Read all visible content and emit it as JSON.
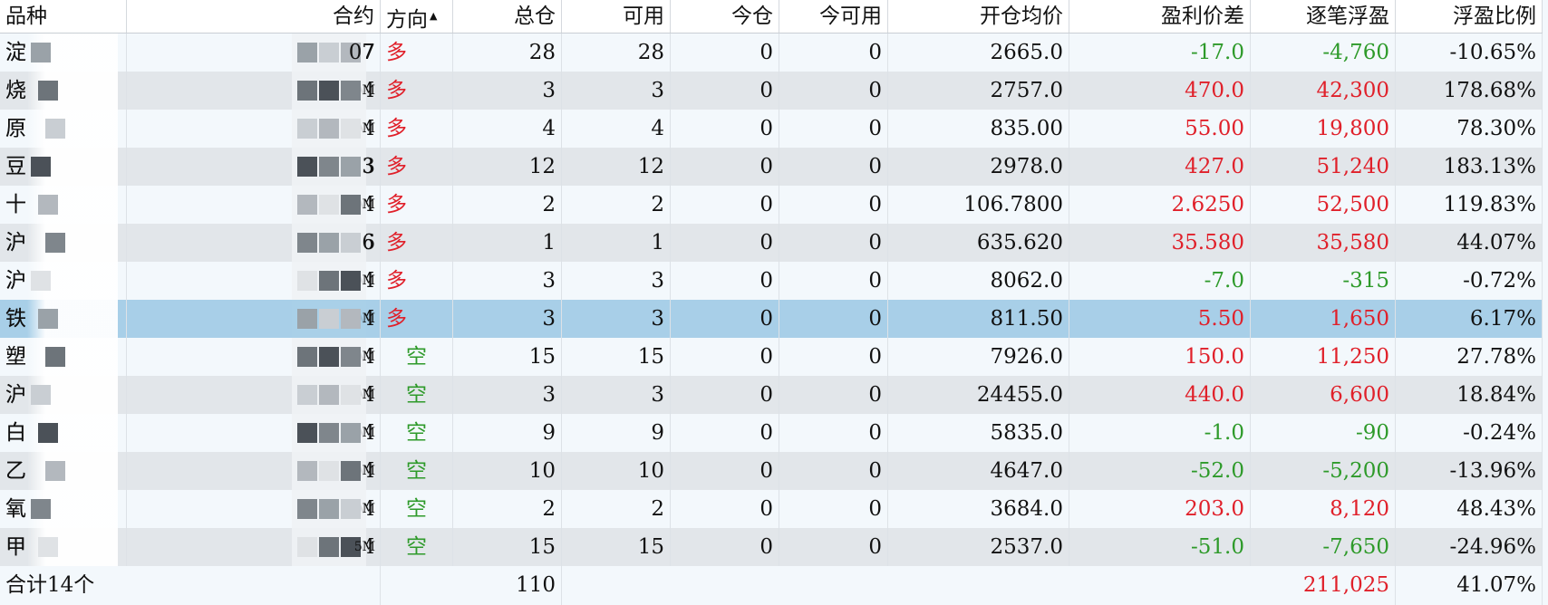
{
  "columns": [
    {
      "key": "variety",
      "label": "品种"
    },
    {
      "key": "contract",
      "label": "合约"
    },
    {
      "key": "direction",
      "label": "方向"
    },
    {
      "key": "total",
      "label": "总仓"
    },
    {
      "key": "available",
      "label": "可用"
    },
    {
      "key": "today",
      "label": "今仓"
    },
    {
      "key": "today_avail",
      "label": "今可用"
    },
    {
      "key": "open_avg",
      "label": "开仓均价"
    },
    {
      "key": "pnl_diff",
      "label": "盈利价差"
    },
    {
      "key": "float_pnl",
      "label": "逐笔浮盈"
    },
    {
      "key": "float_ratio",
      "label": "浮盈比例"
    }
  ],
  "sort_indicator": "▲",
  "rows": [
    {
      "variety": "淀",
      "contract": "07",
      "direction": "多",
      "dir_color": "red",
      "total": "28",
      "available": "28",
      "today": "0",
      "today_avail": "0",
      "open_avg": "2665.0",
      "pnl_diff": "-17.0",
      "pnl_color": "green",
      "float_pnl": "-4,760",
      "float_ratio": "-10.65%"
    },
    {
      "variety": "烧",
      "contract": "M",
      "direction": "多",
      "dir_color": "red",
      "total": "3",
      "available": "3",
      "today": "0",
      "today_avail": "0",
      "open_avg": "2757.0",
      "pnl_diff": "470.0",
      "pnl_color": "red",
      "float_pnl": "42,300",
      "float_ratio": "178.68%"
    },
    {
      "variety": "原",
      "contract": "M",
      "direction": "多",
      "dir_color": "red",
      "total": "4",
      "available": "4",
      "today": "0",
      "today_avail": "0",
      "open_avg": "835.00",
      "pnl_diff": "55.00",
      "pnl_color": "red",
      "float_pnl": "19,800",
      "float_ratio": "78.30%"
    },
    {
      "variety": "豆",
      "contract": "3",
      "direction": "多",
      "dir_color": "red",
      "total": "12",
      "available": "12",
      "today": "0",
      "today_avail": "0",
      "open_avg": "2978.0",
      "pnl_diff": "427.0",
      "pnl_color": "red",
      "float_pnl": "51,240",
      "float_ratio": "183.13%"
    },
    {
      "variety": "十",
      "contract": "M",
      "direction": "多",
      "dir_color": "red",
      "total": "2",
      "available": "2",
      "today": "0",
      "today_avail": "0",
      "open_avg": "106.7800",
      "pnl_diff": "2.6250",
      "pnl_color": "red",
      "float_pnl": "52,500",
      "float_ratio": "119.83%"
    },
    {
      "variety": "沪",
      "contract": "6",
      "direction": "多",
      "dir_color": "red",
      "total": "1",
      "available": "1",
      "today": "0",
      "today_avail": "0",
      "open_avg": "635.620",
      "pnl_diff": "35.580",
      "pnl_color": "red",
      "float_pnl": "35,580",
      "float_ratio": "44.07%"
    },
    {
      "variety": "沪",
      "contract": "M",
      "direction": "多",
      "dir_color": "red",
      "total": "3",
      "available": "3",
      "today": "0",
      "today_avail": "0",
      "open_avg": "8062.0",
      "pnl_diff": "-7.0",
      "pnl_color": "green",
      "float_pnl": "-315",
      "float_ratio": "-0.72%"
    },
    {
      "variety": "铁",
      "contract": "M",
      "direction": "多",
      "dir_color": "red",
      "total": "3",
      "available": "3",
      "today": "0",
      "today_avail": "0",
      "open_avg": "811.50",
      "pnl_diff": "5.50",
      "pnl_color": "red",
      "float_pnl": "1,650",
      "float_ratio": "6.17%",
      "selected": true
    },
    {
      "variety": "塑",
      "contract": "M",
      "direction": "空",
      "dir_color": "green",
      "total": "15",
      "available": "15",
      "today": "0",
      "today_avail": "0",
      "open_avg": "7926.0",
      "pnl_diff": "150.0",
      "pnl_color": "red",
      "float_pnl": "11,250",
      "float_ratio": "27.78%"
    },
    {
      "variety": "沪",
      "contract": "M",
      "direction": "空",
      "dir_color": "green",
      "total": "3",
      "available": "3",
      "today": "0",
      "today_avail": "0",
      "open_avg": "24455.0",
      "pnl_diff": "440.0",
      "pnl_color": "red",
      "float_pnl": "6,600",
      "float_ratio": "18.84%"
    },
    {
      "variety": "白",
      "contract": "M",
      "direction": "空",
      "dir_color": "green",
      "total": "9",
      "available": "9",
      "today": "0",
      "today_avail": "0",
      "open_avg": "5835.0",
      "pnl_diff": "-1.0",
      "pnl_color": "green",
      "float_pnl": "-90",
      "float_ratio": "-0.24%"
    },
    {
      "variety": "乙",
      "contract": "M",
      "direction": "空",
      "dir_color": "green",
      "total": "10",
      "available": "10",
      "today": "0",
      "today_avail": "0",
      "open_avg": "4647.0",
      "pnl_diff": "-52.0",
      "pnl_color": "green",
      "float_pnl": "-5,200",
      "float_ratio": "-13.96%"
    },
    {
      "variety": "氧",
      "contract": "M",
      "direction": "空",
      "dir_color": "green",
      "total": "2",
      "available": "2",
      "today": "0",
      "today_avail": "0",
      "open_avg": "3684.0",
      "pnl_diff": "203.0",
      "pnl_color": "red",
      "float_pnl": "8,120",
      "float_ratio": "48.43%"
    },
    {
      "variety": "甲",
      "contract": "5M",
      "direction": "空",
      "dir_color": "green",
      "total": "15",
      "available": "15",
      "today": "0",
      "today_avail": "0",
      "open_avg": "2537.0",
      "pnl_diff": "-51.0",
      "pnl_color": "green",
      "float_pnl": "-7,650",
      "float_ratio": "-24.96%"
    }
  ],
  "totals": {
    "label": "合计14个",
    "total": "110",
    "float_pnl": "211,025",
    "float_ratio": "41.07%"
  },
  "colors": {
    "red": "#e0202a",
    "green": "#2e9a2a",
    "selected": "#a8cfe8"
  }
}
